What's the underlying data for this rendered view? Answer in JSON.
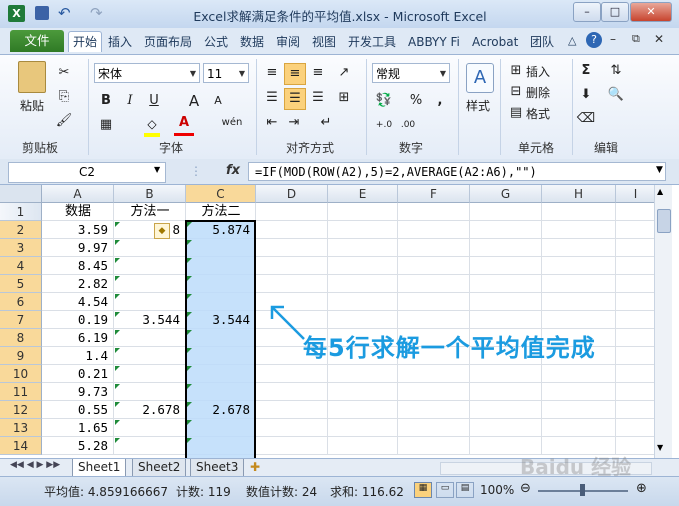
{
  "window": {
    "title": "Excel求解满足条件的平均值.xlsx - Microsoft Excel",
    "min": "–",
    "max": "□",
    "close": "✕"
  },
  "quick_access": {
    "undo": "↶",
    "redo": "↷"
  },
  "tabs": [
    "文件",
    "开始",
    "插入",
    "页面布局",
    "公式",
    "数据",
    "审阅",
    "视图",
    "开发工具",
    "ABBYY Fi",
    "Acrobat",
    "团队"
  ],
  "ribbon": {
    "clipboard": {
      "label": "剪贴板",
      "paste": "粘贴"
    },
    "font": {
      "label": "字体",
      "name": "宋体",
      "size": "11",
      "bold": "B",
      "italic": "I",
      "underline": "U",
      "grow": "A",
      "shrink": "A",
      "fontcolor": "A",
      "wen": "wén"
    },
    "align": {
      "label": "对齐方式"
    },
    "number": {
      "label": "数字",
      "format": "常规",
      "percent": "%",
      "comma": ","
    },
    "styles": {
      "label": "样式"
    },
    "cells": {
      "label": "单元格",
      "insert": "插入",
      "delete": "删除",
      "format": "格式"
    },
    "edit": {
      "label": "编辑",
      "sum": "Σ"
    }
  },
  "formula_bar": {
    "name_box": "C2",
    "fx": "fx",
    "formula": "=IF(MOD(ROW(A2),5)=2,AVERAGE(A2:A6),\"\")"
  },
  "columns": [
    "A",
    "B",
    "C",
    "D",
    "E",
    "F",
    "G",
    "H",
    "I"
  ],
  "rows": [
    {
      "n": "1",
      "a": "数据",
      "b": "方法一",
      "c": "方法二"
    },
    {
      "n": "2",
      "a": "3.59",
      "b": "5.8",
      "c": "5.874"
    },
    {
      "n": "3",
      "a": "9.97",
      "b": "",
      "c": ""
    },
    {
      "n": "4",
      "a": "8.45",
      "b": "",
      "c": ""
    },
    {
      "n": "5",
      "a": "2.82",
      "b": "",
      "c": ""
    },
    {
      "n": "6",
      "a": "4.54",
      "b": "",
      "c": ""
    },
    {
      "n": "7",
      "a": "0.19",
      "b": "3.544",
      "c": "3.544"
    },
    {
      "n": "8",
      "a": "6.19",
      "b": "",
      "c": ""
    },
    {
      "n": "9",
      "a": "1.4",
      "b": "",
      "c": ""
    },
    {
      "n": "10",
      "a": "0.21",
      "b": "",
      "c": ""
    },
    {
      "n": "11",
      "a": "9.73",
      "b": "",
      "c": ""
    },
    {
      "n": "12",
      "a": "0.55",
      "b": "2.678",
      "c": "2.678"
    },
    {
      "n": "13",
      "a": "1.65",
      "b": "",
      "c": ""
    },
    {
      "n": "14",
      "a": "5.28",
      "b": "",
      "c": ""
    }
  ],
  "annotation": "每5行求解一个平均值完成",
  "sheets": [
    "Sheet1",
    "Sheet2",
    "Sheet3"
  ],
  "status": {
    "average": "平均值: 4.859166667",
    "count": "计数: 119",
    "numcount": "数值计数: 24",
    "sum": "求和: 116.62",
    "zoom": "100%"
  },
  "watermark": "Baidu 经验",
  "colors": {
    "accent": "#1b9be0",
    "file_tab": "#2f7a25",
    "selection": "#bcdcfa"
  }
}
